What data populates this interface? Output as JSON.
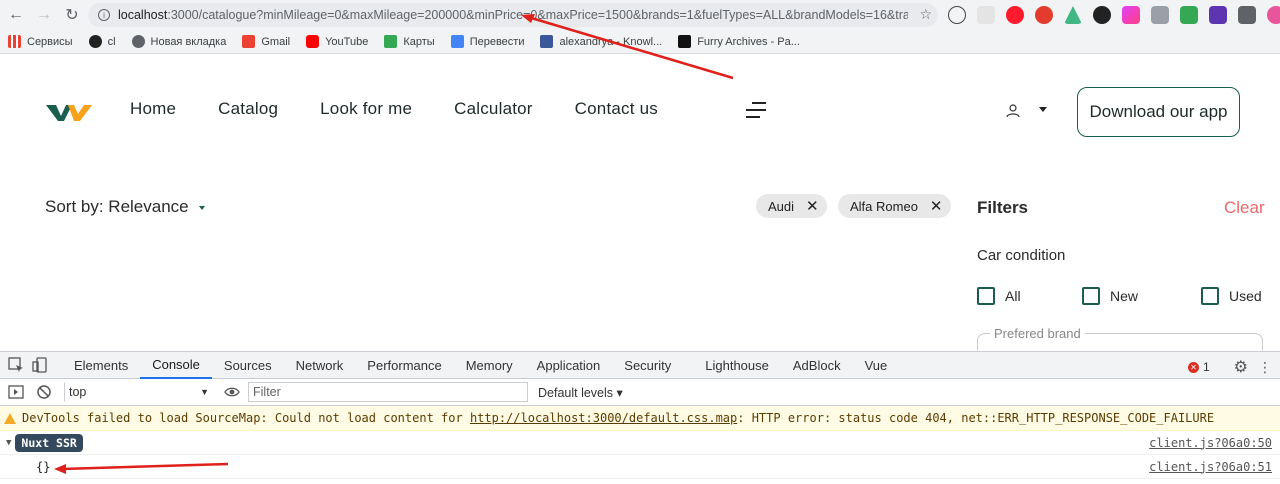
{
  "browser": {
    "url_host": "localhost",
    "url_path": ":3000/catalogue?minMileage=0&maxMileage=200000&minPrice=0&maxPrice=1500&brands=1&fuelTypes=ALL&brandModels=16&trans...",
    "bookmarks": [
      "Сервисы",
      "cl",
      "Новая вкладка",
      "Gmail",
      "YouTube",
      "Карты",
      "Перевести",
      "alexandrya - Knowl...",
      "Furry Archives - Pa..."
    ]
  },
  "site": {
    "nav": [
      "Home",
      "Catalog",
      "Look for me",
      "Calculator",
      "Contact us"
    ],
    "download_label": "Download our app",
    "sort_label": "Sort by: Relevance",
    "chips": [
      "Audi",
      "Alfa Romeo"
    ],
    "filters_title": "Filters",
    "clear_label": "Clear",
    "car_condition_label": "Car condition",
    "conditions": [
      "All",
      "New",
      "Used"
    ],
    "preferred_brand_label": "Prefered brand"
  },
  "devtools": {
    "tabs": [
      "Elements",
      "Console",
      "Sources",
      "Network",
      "Performance",
      "Memory",
      "Application",
      "Security",
      "Lighthouse",
      "AdBlock",
      "Vue"
    ],
    "active_tab": "Console",
    "error_count": "1",
    "context": "top",
    "filter_placeholder": "Filter",
    "levels": "Default levels ▾",
    "warning_prefix": "DevTools failed to load SourceMap: Could not load content for ",
    "warning_link": "http://localhost:3000/default.css.map",
    "warning_suffix": ": HTTP error: status code 404, net::ERR_HTTP_RESPONSE_CODE_FAILURE",
    "log_badge": "Nuxt SSR",
    "log_src_1": "client.js?06a0:50",
    "log_value": "{}",
    "log_src_2": "client.js?06a0:51"
  },
  "colors": {
    "accent": "#1b5e4f",
    "clear": "#e96a6a",
    "annotation": "#e0201b"
  }
}
